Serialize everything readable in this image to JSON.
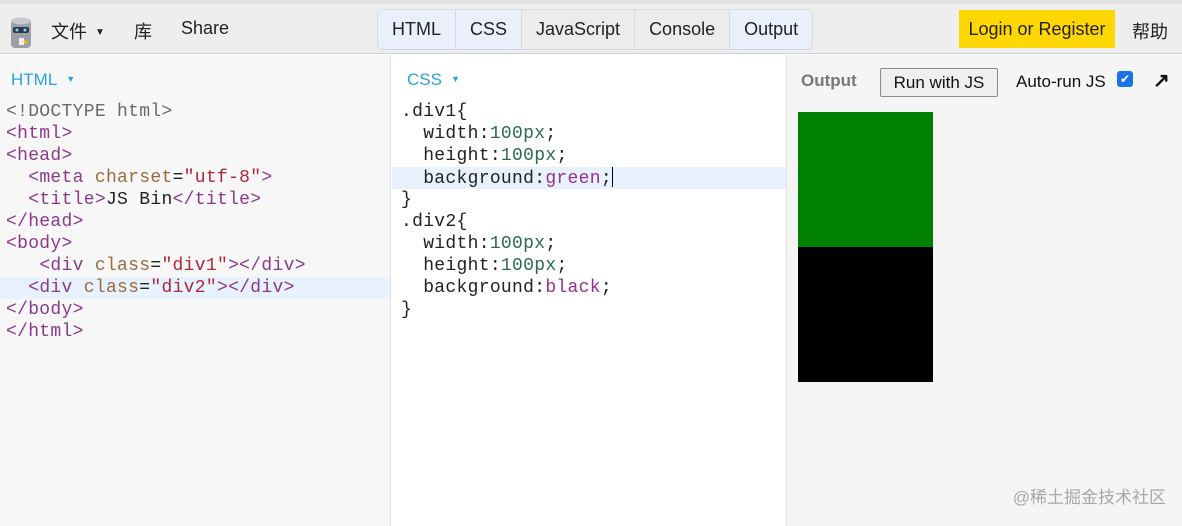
{
  "topbar": {
    "file_menu": "文件",
    "library": "库",
    "share": "Share",
    "tabs": [
      {
        "label": "HTML",
        "active": true
      },
      {
        "label": "CSS",
        "active": true
      },
      {
        "label": "JavaScript",
        "active": false
      },
      {
        "label": "Console",
        "active": false
      },
      {
        "label": "Output",
        "active": true
      }
    ],
    "login": "Login or Register",
    "help": "帮助"
  },
  "html_panel": {
    "label": "HTML",
    "active_line": 8,
    "lines": [
      [
        [
          "t-punc",
          "<!DOCTYPE html>"
        ]
      ],
      [
        [
          "t-tag",
          "<html>"
        ]
      ],
      [
        [
          "t-tag",
          "<head>"
        ]
      ],
      [
        [
          "t-txt",
          "  "
        ],
        [
          "t-tag",
          "<meta "
        ],
        [
          "t-attr",
          "charset"
        ],
        [
          "t-txt",
          "="
        ],
        [
          "t-str",
          "\"utf-8\""
        ],
        [
          "t-tag",
          ">"
        ]
      ],
      [
        [
          "t-txt",
          "  "
        ],
        [
          "t-tag",
          "<title>"
        ],
        [
          "t-txt",
          "JS Bin"
        ],
        [
          "t-tag",
          "</title>"
        ]
      ],
      [
        [
          "t-tag",
          "</head>"
        ]
      ],
      [
        [
          "t-tag",
          "<body>"
        ]
      ],
      [
        [
          "t-txt",
          "   "
        ],
        [
          "t-tag",
          "<div "
        ],
        [
          "t-attr",
          "class"
        ],
        [
          "t-txt",
          "="
        ],
        [
          "t-str",
          "\"div1\""
        ],
        [
          "t-tag",
          "></div>"
        ]
      ],
      [
        [
          "t-txt",
          "  "
        ],
        [
          "t-tag",
          "<div "
        ],
        [
          "t-attr",
          "class"
        ],
        [
          "t-txt",
          "="
        ],
        [
          "t-str",
          "\"div2\""
        ],
        [
          "t-tag",
          "></div>"
        ]
      ],
      [
        [
          "t-tag",
          "</body>"
        ]
      ],
      [
        [
          "t-tag",
          "</html>"
        ]
      ]
    ]
  },
  "css_panel": {
    "label": "CSS",
    "active_line": 3,
    "lines": [
      [
        [
          "t-txt",
          ".div1{"
        ]
      ],
      [
        [
          "t-txt",
          "  width:"
        ],
        [
          "t-num",
          "100px"
        ],
        [
          "t-txt",
          ";"
        ]
      ],
      [
        [
          "t-txt",
          "  height:"
        ],
        [
          "t-num",
          "100px"
        ],
        [
          "t-txt",
          ";"
        ]
      ],
      [
        [
          "t-txt",
          "  background:"
        ],
        [
          "t-kw",
          "green"
        ],
        [
          "t-txt",
          ";"
        ]
      ],
      [
        [
          "t-txt",
          "}"
        ]
      ],
      [
        [
          "t-txt",
          ".div2{"
        ]
      ],
      [
        [
          "t-txt",
          "  width:"
        ],
        [
          "t-num",
          "100px"
        ],
        [
          "t-txt",
          ";"
        ]
      ],
      [
        [
          "t-txt",
          "  height:"
        ],
        [
          "t-num",
          "100px"
        ],
        [
          "t-txt",
          ";"
        ]
      ],
      [
        [
          "t-txt",
          "  background:"
        ],
        [
          "t-kw",
          "black"
        ],
        [
          "t-txt",
          ";"
        ]
      ],
      [
        [
          "t-txt",
          "}"
        ]
      ]
    ]
  },
  "output_panel": {
    "label": "Output",
    "run_button": "Run with JS",
    "autorun_label": "Auto-run JS",
    "autorun_checked": true,
    "box_colors": [
      "#008000",
      "#000000"
    ]
  },
  "watermark": "@稀土掘金技术社区"
}
